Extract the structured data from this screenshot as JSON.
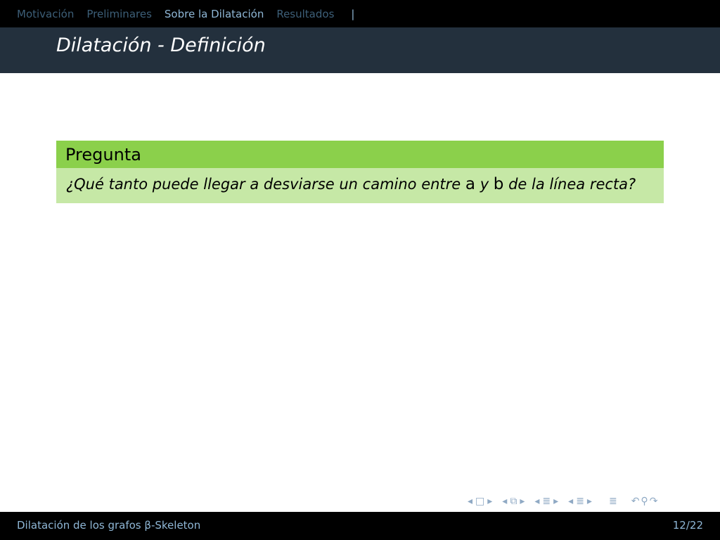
{
  "nav": {
    "sections": [
      "Motivación",
      "Preliminares",
      "Sobre la Dilatación",
      "Resultados"
    ],
    "separator": "|"
  },
  "slide": {
    "title": "Dilatación - Definición",
    "block": {
      "title": "Pregunta",
      "text_before": "¿Qué tanto puede llegar a desviarse un camino entre ",
      "var_a": "a",
      "text_middle": " y ",
      "var_b": "b",
      "text_after": " de la línea recta?"
    }
  },
  "footer": {
    "title": "Dilatación de los grafos β-Skeleton",
    "page": "12/22"
  },
  "colors": {
    "header_bg": "#000000",
    "title_bg": "#23303d",
    "block_head": "#8bd04b",
    "block_body": "#c6e8a6",
    "nav_active": "#8fb7d6",
    "nav_inactive": "#3d5f78"
  }
}
